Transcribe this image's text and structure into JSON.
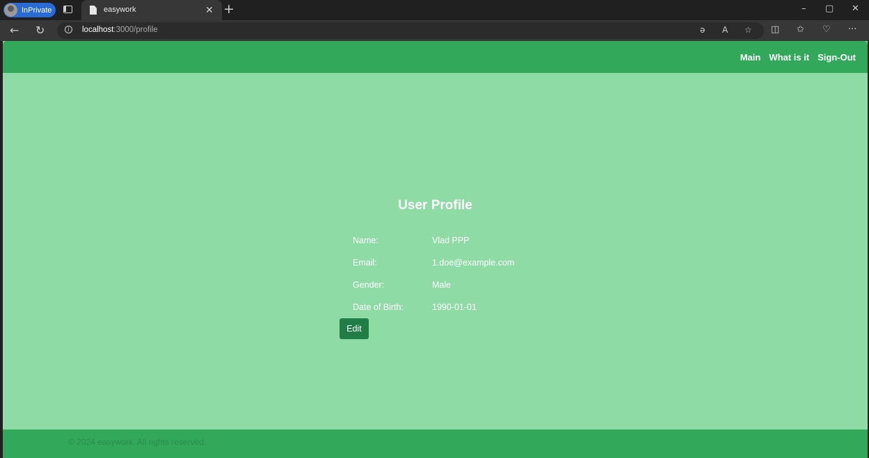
{
  "browser": {
    "inprivate_label": "InPrivate",
    "tab_title": "easywork",
    "tab_close": "✕",
    "new_tab": "+",
    "url_host": "localhost",
    "url_path": ":3000/profile",
    "window_minimize": "–",
    "window_restore": "▢",
    "window_close": "✕",
    "more_icon": "···"
  },
  "site": {
    "nav": [
      "Main",
      "What is it",
      "Sign-Out"
    ],
    "footer_text": "© 2024 easywork. All rights reserved."
  },
  "profile": {
    "title": "User Profile",
    "fields": [
      {
        "label": "Name:",
        "value": "Vlad PPP"
      },
      {
        "label": "Email:",
        "value": "1.doe@example.com"
      },
      {
        "label": "Gender:",
        "value": "Male"
      },
      {
        "label": "Date of Birth:",
        "value": "1990-01-01"
      }
    ],
    "edit_label": "Edit"
  }
}
